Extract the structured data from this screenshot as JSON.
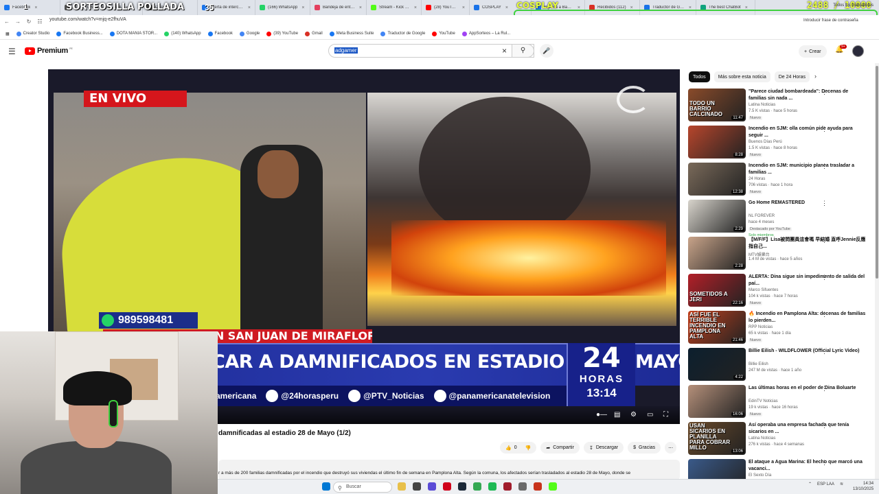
{
  "browser": {
    "tabs": [
      {
        "label": "Facebook",
        "color": "#1877f2"
      },
      {
        "label": "SORTEOSILLA POLLADA",
        "color": "#555555"
      },
      {
        "label": "Otros",
        "color": "#555555"
      },
      {
        "label": "Oferta de intercambio",
        "color": "#1a73e8"
      },
      {
        "label": "(166) WhatsApp",
        "color": "#25d366"
      },
      {
        "label": "Bandeja de entrada",
        "color": "#e4405f"
      },
      {
        "label": "Stream - Kick Dashboard",
        "color": "#53fc18"
      },
      {
        "label": "(28) YouTube",
        "color": "#ff0000"
      },
      {
        "label": "COSPLAY",
        "color": "#1a73e8"
      },
      {
        "label": "Ingresa a Banca por",
        "color": "#1a73e8"
      },
      {
        "label": "Recibidos (112)",
        "color": "#d93025"
      },
      {
        "label": "Traductor de Google",
        "color": "#1a73e8"
      },
      {
        "label": "The best ChatBot",
        "color": "#10a37f"
      }
    ],
    "url": "youtube.com/watch?v=mjq-e2fhuVA",
    "password_hint": "Introducir frase de contraseña",
    "bookmarks": [
      "Creator Studio",
      "Facebook Business...",
      "DOTA MANIA STOR...",
      "(140) WhatsApp",
      "Facebook",
      "Google",
      "(39) YouTube",
      "Gmail",
      "Meta Business Suite",
      "Traductor de Google",
      "YouTube",
      "AppSorteos – La Rul..."
    ],
    "bookmarks_all": "Todos los marcadores"
  },
  "overlay": {
    "sorteo": "SORTEOSILLA POLLADA",
    "num1": "1",
    "num35": "35",
    "cosplay": "COSPLAY",
    "score": "2488 / 10000"
  },
  "youtube": {
    "logo": "Premium",
    "logo_region": "PE",
    "search_query": "adgamer",
    "create_label": "Crear",
    "notif_count": "9+",
    "video": {
      "live_label": "EN VIVO",
      "phone": "989598481",
      "lower_red": "DAMNIFICADOS EN SAN JUAN DE MIRAFLORES",
      "headline": "CAR A DAMNIFICADOS EN ESTADIO 28 DE MAYO",
      "logo_num": "24",
      "logo_word": "HORAS",
      "logo_time": "13:14",
      "social": [
        "americana",
        "@24horasperu",
        "@PTV_Noticias",
        "@panamericanatelevision"
      ]
    },
    "title": "damnificadas al estadio 28 de Mayo (1/2)",
    "like_count": "0",
    "actions": {
      "share": "Compartir",
      "download": "Descargar",
      "thanks": "Gracias"
    },
    "description": "r a más de 200 familias damnificadas por el incendio que destruyó sus viviendas el último fin de semana en Pamplona Alta. Según la comuna, los afectados serían trasladados al estadio 28 de Mayo, donde se",
    "chips": [
      "Todos",
      "Más sobre esta noticia",
      "De 24 Horas"
    ],
    "recommendations": [
      {
        "title": "\"Parece ciudad bombardeada\": Decenas de familias sin nada ...",
        "channel": "Latina Noticias",
        "meta": "7.5 K vistas · hace 5 horas",
        "badge": "Nuevo",
        "duration": "11:47",
        "overlay": "TODO UN BARRIO CALCINADO",
        "color": "#8a4b2a"
      },
      {
        "title": "Incendio en SJM: olla común pide ayuda para seguir ...",
        "channel": "Buenos Días Perú",
        "meta": "1.5 K vistas · hace 8 horas",
        "badge": "Nuevo",
        "duration": "8:28",
        "overlay": "",
        "color": "#b8462c"
      },
      {
        "title": "Incendio en SJM: municipio planea trasladar a familias ...",
        "channel": "24 Horas",
        "meta": "706 vistas · hace 1 hora",
        "badge": "Nuevo",
        "duration": "12:38",
        "overlay": "",
        "color": "#7a6a5a"
      },
      {
        "title": "Go Home REMASTERED",
        "channel": "NL FOREVER",
        "meta": "hace 4 meses",
        "badge": "Destacado por YouTube",
        "badge2": "Solo miembros",
        "duration": "2:29",
        "overlay": "",
        "color": "#d8d4cc"
      },
      {
        "title": "【M/F/F】Lisa被問團員這會嗎 早結婚 直呼Jennie反應指自己...",
        "channel": "MTV娛樂台",
        "meta": "1.4 M de vistas · hace 5 años",
        "badge": "",
        "duration": "2:28",
        "overlay": "",
        "color": "#c9a48a"
      },
      {
        "title": "ALERTA: Dina sigue sin impedimento de salida del paí...",
        "channel": "Marco Sifuentes",
        "meta": "104 k vistas · hace 7 horas",
        "badge": "Nuevo",
        "duration": "22:16",
        "overlay": "SOMETIDOS A JERI",
        "color": "#b22028"
      },
      {
        "title": "🔥 Incendio en Pamplona Alta: decenas de familias lo pierden...",
        "channel": "RPP Noticias",
        "meta": "65 k vistas · hace 1 día",
        "badge": "Nuevo",
        "duration": "21:46",
        "overlay": "ASÍ FUE EL TERRIBLE INCENDIO EN PAMPLONA ALTA",
        "color": "#c2411e"
      },
      {
        "title": "Billie Eilish - WILDFLOWER (Official Lyric Video)",
        "channel": "Billie Eilish",
        "meta": "247 M de vistas · hace 1 año",
        "badge": "",
        "duration": "4:22",
        "overlay": "",
        "color": "#0c1f2e"
      },
      {
        "title": "Las últimas horas en el poder de Dina Boluarte",
        "channel": "EdinTV Noticias",
        "meta": "19 k vistas · hace 16 horas",
        "badge": "Nuevo",
        "duration": "16:06",
        "overlay": "",
        "color": "#b5907a"
      },
      {
        "title": "Así operaba una empresa fachada que tenía sicarios en ...",
        "channel": "Latina Noticias",
        "meta": "276 k vistas · hace 4 semanas",
        "badge": "",
        "duration": "13:06",
        "overlay": "USAN SICARIOS EN PLANILLA PARA COBRAR MILLO",
        "color": "#6a4a2a"
      },
      {
        "title": "El ataque a Agua Marina: El hecho que marcó una vacanci...",
        "channel": "El Sexto Día",
        "meta": "17 k vistas · hace 2 días",
        "badge": "",
        "duration": "",
        "overlay": "",
        "color": "#3a5a8a"
      }
    ]
  },
  "taskbar": {
    "search": "Buscar",
    "lang": "ESP LAA",
    "time": "14:34",
    "date": "13/10/2025"
  }
}
